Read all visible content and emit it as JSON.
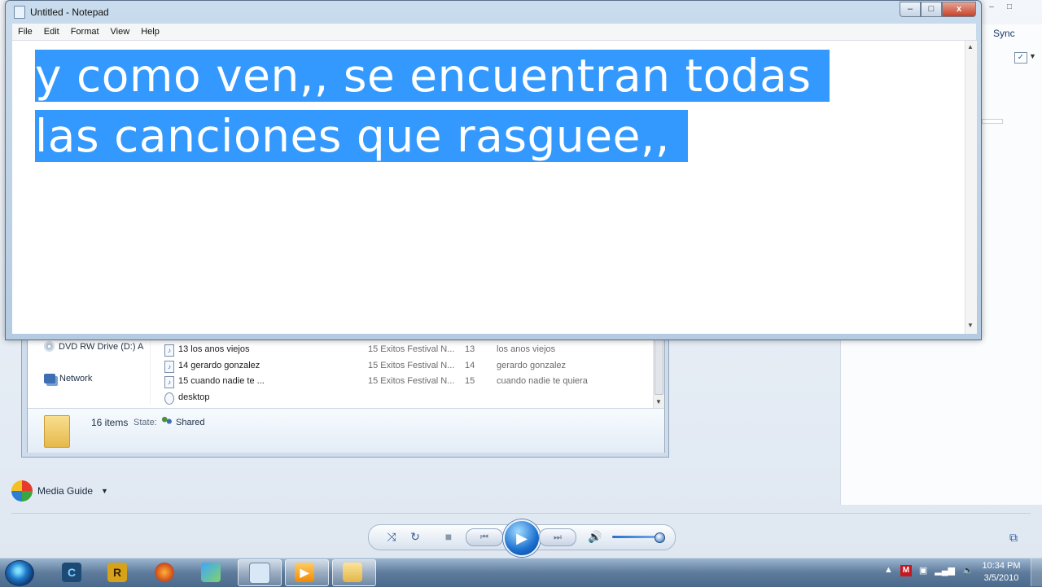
{
  "notepad": {
    "title": "Untitled - Notepad",
    "menu": [
      "File",
      "Edit",
      "Format",
      "View",
      "Help"
    ],
    "text_line1": "y como ven,, se encuentran todas",
    "text_line2": "las canciones que rasguee,,",
    "minimize": "–",
    "maximize": "□",
    "close": "x"
  },
  "media_player": {
    "sync_tab": "Sync",
    "media_guide": "Media Guide"
  },
  "explorer": {
    "nav": {
      "dvd": "DVD RW Drive (D:) A",
      "network": "Network"
    },
    "rows": [
      {
        "name": "13 los anos viejos",
        "album": "15 Exitos Festival N...",
        "num": "13",
        "title": "los anos viejos"
      },
      {
        "name": "14 gerardo gonzalez",
        "album": "15 Exitos Festival N...",
        "num": "14",
        "title": "gerardo gonzalez"
      },
      {
        "name": "15 cuando nadie te ...",
        "album": "15 Exitos Festival N...",
        "num": "15",
        "title": "cuando nadie te quiera"
      },
      {
        "name": "desktop",
        "album": "",
        "num": "",
        "title": ""
      }
    ],
    "details": {
      "count": "16 items",
      "state_label": "State:",
      "state_value": "Shared"
    }
  },
  "taskbar": {
    "clock_time": "10:34 PM",
    "clock_date": "3/5/2010"
  },
  "icons": {
    "shuffle": "⤨",
    "repeat": "↻",
    "stop": "■",
    "prev": "⏮",
    "play": "▶",
    "next": "⏭",
    "volume": "🔊"
  },
  "colors": {
    "selection": "#3399ff",
    "titlebar": "#c9dced"
  }
}
